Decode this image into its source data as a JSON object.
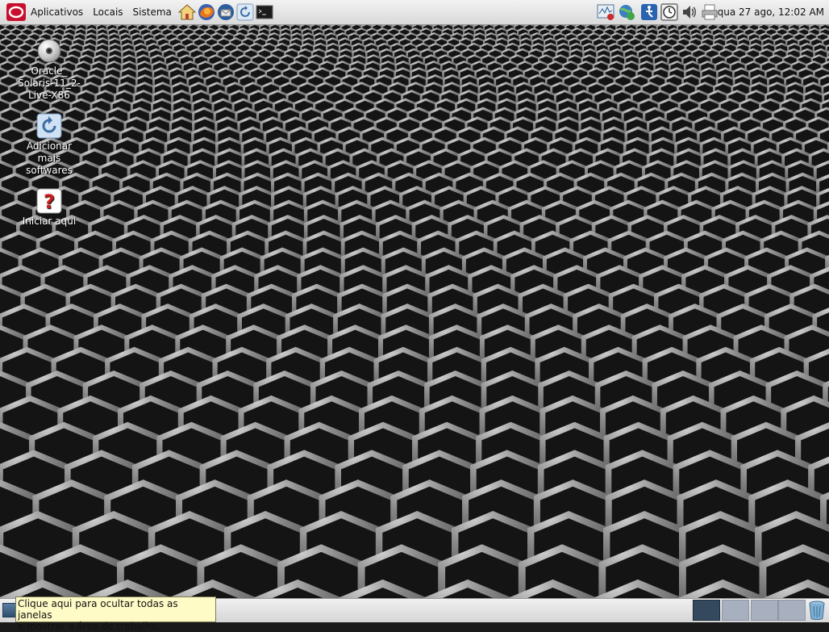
{
  "top_panel": {
    "menus": [
      "Aplicativos",
      "Locais",
      "Sistema"
    ],
    "clock": "qua 27 ago, 12:02 AM",
    "launchers": [
      "home-icon",
      "firefox-icon",
      "thunderbird-icon",
      "update-manager-icon",
      "terminal-icon"
    ],
    "tray_icons": [
      "system-monitor-icon",
      "network-icon",
      "accessibility-icon",
      "time-slider-icon",
      "volume-icon",
      "printer-icon"
    ]
  },
  "desktop": {
    "icons": [
      {
        "name": "disc-icon",
        "label": "Oracle_\nSolaris-11_2-\nLive-X86"
      },
      {
        "name": "package-update-icon",
        "label": "Adicionar\nmais\nsoftwares"
      },
      {
        "name": "help-icon",
        "label": "Iniciar aqui"
      }
    ]
  },
  "bottom_panel": {
    "tooltip": "Clique aqui para ocultar todas as janelas\ne mostrar a área de trabalho.",
    "workspaces": 4,
    "active_workspace": 1
  },
  "colors": {
    "panel": "#e6e6e6",
    "tooltip_bg": "#fffbc6",
    "active_workspace": "#34495e",
    "inactive_workspace": "#a8b0bf"
  }
}
